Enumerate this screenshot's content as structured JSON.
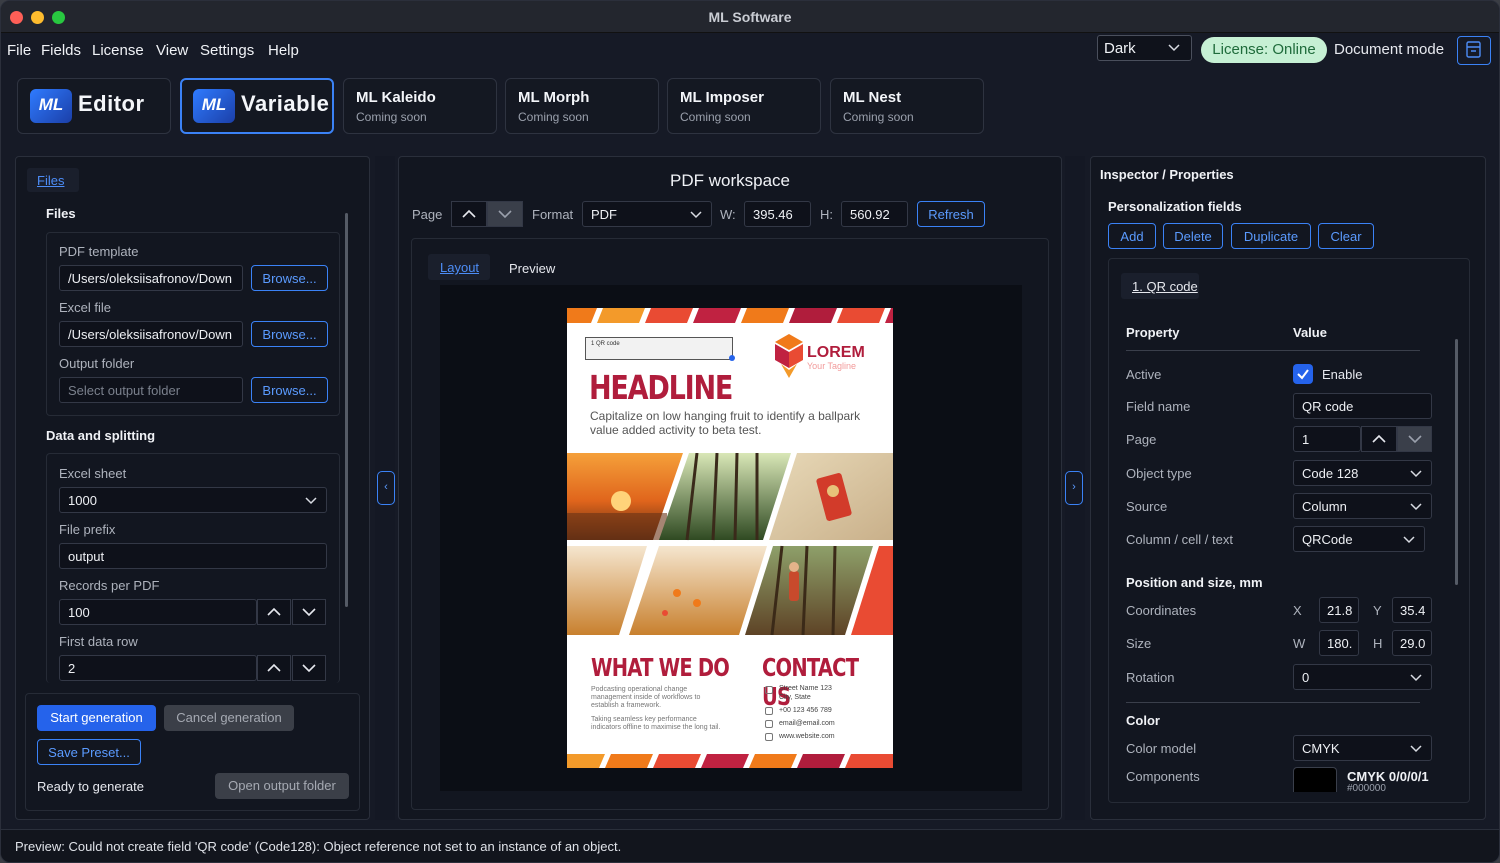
{
  "window": {
    "title": "ML Software"
  },
  "menu": [
    "File",
    "Fields",
    "License",
    "View",
    "Settings",
    "Help"
  ],
  "topbar": {
    "theme": "Dark",
    "license": "License: Online",
    "doc_mode": "Document mode"
  },
  "app_tabs": [
    {
      "logo": "ML",
      "name": "Editor"
    },
    {
      "logo": "ML",
      "name": "Variable"
    },
    {
      "name": "ML Kaleido",
      "sub": "Coming soon"
    },
    {
      "name": "ML Morph",
      "sub": "Coming soon"
    },
    {
      "name": "ML Imposer",
      "sub": "Coming soon"
    },
    {
      "name": "ML Nest",
      "sub": "Coming soon"
    }
  ],
  "left": {
    "tab": "Files",
    "files_heading": "Files",
    "pdf_template_label": "PDF template",
    "pdf_template_value": "/Users/oleksiisafronov/Down",
    "excel_file_label": "Excel file",
    "excel_file_value": "/Users/oleksiisafronov/Down",
    "output_folder_label": "Output folder",
    "output_folder_placeholder": "Select output folder",
    "browse": "Browse...",
    "data_heading": "Data and splitting",
    "excel_sheet_label": "Excel sheet",
    "excel_sheet_value": "1000",
    "file_prefix_label": "File prefix",
    "file_prefix_value": "output",
    "records_label": "Records per PDF",
    "records_value": "100",
    "first_row_label": "First data row",
    "first_row_value": "2",
    "start": "Start generation",
    "cancel": "Cancel generation",
    "save_preset": "Save Preset...",
    "ready": "Ready to generate",
    "open_output": "Open output folder"
  },
  "workspace": {
    "title": "PDF workspace",
    "page_label": "Page",
    "format_label": "Format",
    "format_value": "PDF",
    "w_label": "W:",
    "w_value": "395.46",
    "h_label": "H:",
    "h_value": "560.92",
    "refresh": "Refresh",
    "tab_layout": "Layout",
    "tab_preview": "Preview"
  },
  "poster": {
    "qr_label": "1  QR code",
    "brand": "LOREM",
    "tagline": "Your Tagline",
    "headline": "HEADLINE",
    "sub": "Capitalize on low hanging fruit to identify a ballpark value added activity to beta test.",
    "what": "WHAT WE DO",
    "what_p1": "Podcasting operational change management inside of workflows to establish a framework.",
    "what_p2": "Taking seamless key performance indicators offline to maximise the long tail.",
    "contact": "CONTACT US",
    "address": "Street Name 123",
    "city": "City, State",
    "phone": "+00 123 456 789",
    "email": "email@email.com",
    "web": "www.website.com",
    "colors": {
      "red": "#b01d3c",
      "orange": "#f07a1a",
      "accent": "#d9342b"
    }
  },
  "inspector": {
    "title": "Inspector / Properties",
    "fields_heading": "Personalization fields",
    "add": "Add",
    "delete": "Delete",
    "duplicate": "Duplicate",
    "clear": "Clear",
    "field_tab": "1. QR code",
    "col_property": "Property",
    "col_value": "Value",
    "active_label": "Active",
    "enable": "Enable",
    "field_name_label": "Field name",
    "field_name_value": "QR code",
    "page_label": "Page",
    "page_value": "1",
    "object_type_label": "Object type",
    "object_type_value": "Code 128",
    "source_label": "Source",
    "source_value": "Column",
    "column_label": "Column / cell / text",
    "column_value": "QRCode",
    "pos_heading": "Position and size, mm",
    "coords_label": "Coordinates",
    "x_label": "X",
    "x_value": "21.8",
    "y_label": "Y",
    "y_value": "35.4",
    "size_label": "Size",
    "w_label": "W",
    "w_value": "180.",
    "h_label": "H",
    "h_value": "29.0",
    "rotation_label": "Rotation",
    "rotation_value": "0",
    "color_heading": "Color",
    "color_model_label": "Color model",
    "color_model_value": "CMYK",
    "components_label": "Components",
    "components_value": "CMYK 0/0/0/1",
    "components_hex": "#000000"
  },
  "status": "Preview: Could not create field 'QR code' (Code128): Object reference not set to an instance of an object."
}
